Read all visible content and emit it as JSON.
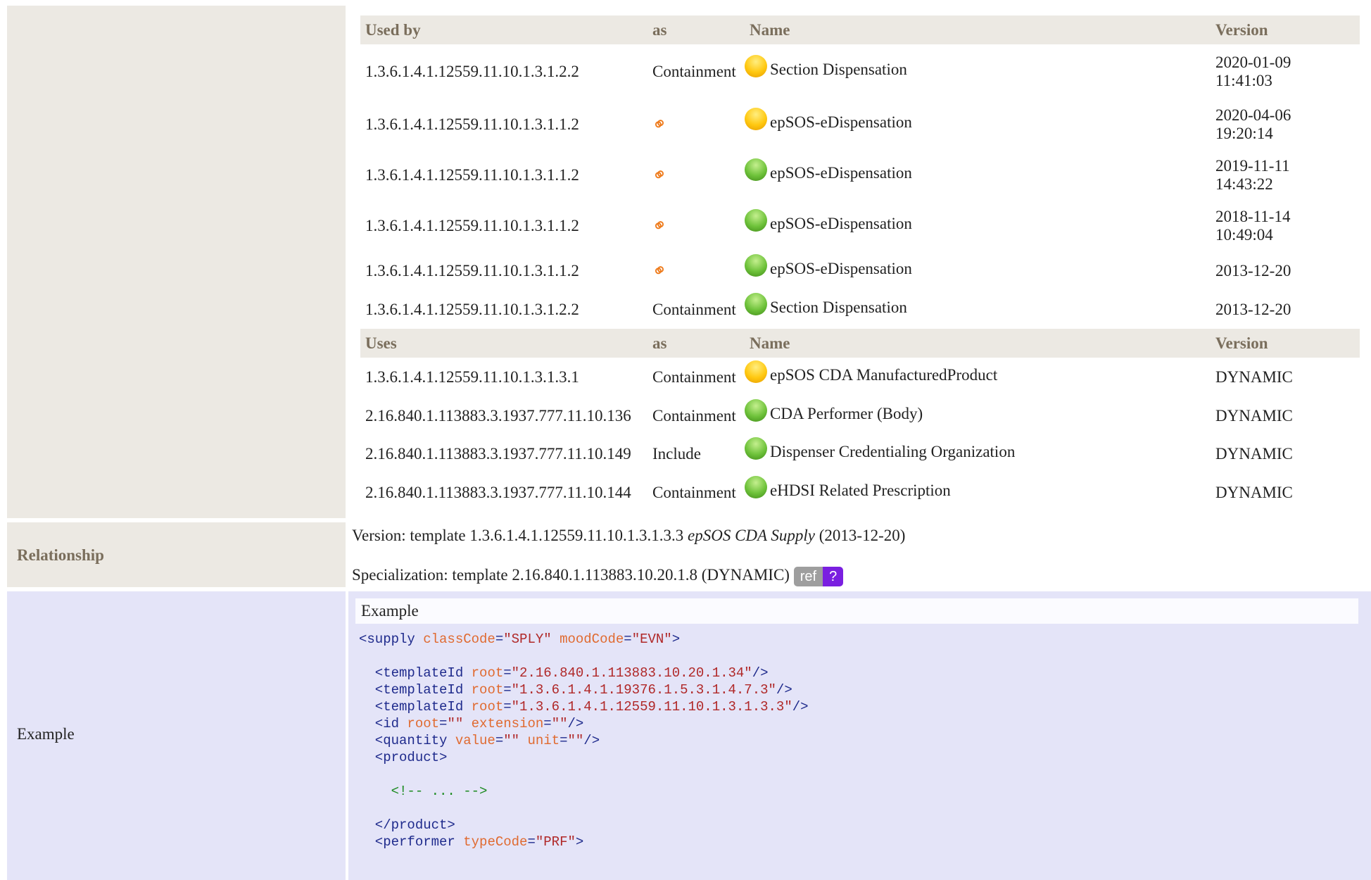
{
  "used_by_header": {
    "col1": "Used by",
    "col2": "as",
    "col3": "Name",
    "col4": "Version"
  },
  "used_by_rows": [
    {
      "id": "1.3.6.1.4.1.12559.11.10.1.3.1.2.2",
      "as": "Containment",
      "status": "yellow",
      "name": "Section Dispensation",
      "v1": "2020-01-09",
      "v2": "11:41:03"
    },
    {
      "id": "1.3.6.1.4.1.12559.11.10.1.3.1.1.2",
      "as": "link-icon",
      "status": "yellow",
      "name": "epSOS-eDispensation",
      "v1": "2020-04-06",
      "v2": "19:20:14"
    },
    {
      "id": "1.3.6.1.4.1.12559.11.10.1.3.1.1.2",
      "as": "link-icon",
      "status": "green",
      "name": "epSOS-eDispensation",
      "v1": "2019-11-11",
      "v2": "14:43:22"
    },
    {
      "id": "1.3.6.1.4.1.12559.11.10.1.3.1.1.2",
      "as": "link-icon",
      "status": "green",
      "name": "epSOS-eDispensation",
      "v1": "2018-11-14",
      "v2": "10:49:04"
    },
    {
      "id": "1.3.6.1.4.1.12559.11.10.1.3.1.1.2",
      "as": "link-icon",
      "status": "green",
      "name": "epSOS-eDispensation",
      "v1": "2013-12-20",
      "v2": ""
    },
    {
      "id": "1.3.6.1.4.1.12559.11.10.1.3.1.2.2",
      "as": "Containment",
      "status": "green",
      "name": "Section Dispensation",
      "v1": "2013-12-20",
      "v2": ""
    }
  ],
  "uses_header": {
    "col1": "Uses",
    "col2": "as",
    "col3": "Name",
    "col4": "Version"
  },
  "uses_rows": [
    {
      "id": "1.3.6.1.4.1.12559.11.10.1.3.1.3.1",
      "as": "Containment",
      "status": "yellow",
      "name": "epSOS CDA ManufacturedProduct",
      "v1": "DYNAMIC"
    },
    {
      "id": "2.16.840.1.113883.3.1937.777.11.10.136",
      "as": "Containment",
      "status": "green",
      "name": "CDA Performer (Body)",
      "v1": "DYNAMIC"
    },
    {
      "id": "2.16.840.1.113883.3.1937.777.11.10.149",
      "as": "Include",
      "status": "green",
      "name": "Dispenser Credentialing Organization",
      "v1": "DYNAMIC"
    },
    {
      "id": "2.16.840.1.113883.3.1937.777.11.10.144",
      "as": "Containment",
      "status": "green",
      "name": "eHDSI Related Prescription",
      "v1": "DYNAMIC"
    }
  ],
  "relationship": {
    "label": "Relationship",
    "version_prefix": "Version: template 1.3.6.1.4.1.12559.11.10.1.3.1.3.3",
    "version_name": "epSOS CDA Supply",
    "version_suffix": "(2013-12-20)",
    "specialization": "Specialization: template 2.16.840.1.113883.10.20.1.8 (DYNAMIC)",
    "ref_label": "ref",
    "help_label": "?"
  },
  "example": {
    "label": "Example",
    "caption": "Example"
  },
  "colors": {
    "status_yellow": "#ffc810",
    "status_green": "#6ec23a",
    "link": "#ee7a1a",
    "help_badge": "#7a1fe0"
  }
}
